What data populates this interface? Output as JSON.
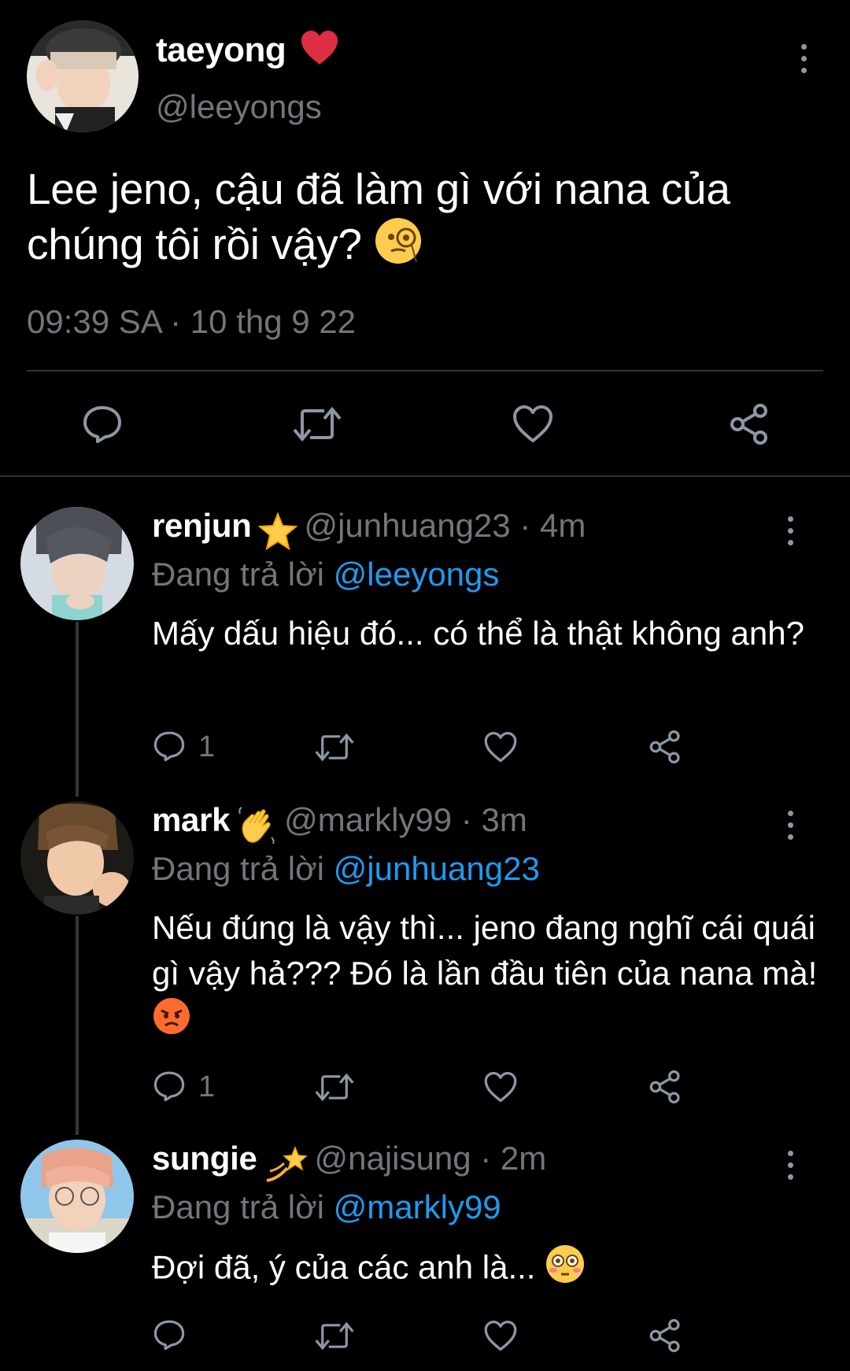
{
  "main_tweet": {
    "name": "taeyong",
    "name_emoji": "heart-emoji",
    "handle": "@leeyongs",
    "text": "Lee jeno, cậu đã làm gì với nana của chúng tôi rồi vậy?",
    "text_emoji": "monocle-face-emoji",
    "timestamp": "09:39 SA · 10 thg 9 22"
  },
  "replies": [
    {
      "name": "renjun",
      "name_emoji": "star-emoji",
      "meta": "@junhuang23 · 4m",
      "replying_prefix": "Đang trả lời",
      "replying_to": "@leeyongs",
      "text": "Mấy dấu hiệu đó... có thể là thật không anh?",
      "reply_count": "1"
    },
    {
      "name": "mark",
      "name_emoji": "waving-hand-emoji",
      "meta": "@markly99 · 3m",
      "replying_prefix": "Đang trả lời",
      "replying_to": "@junhuang23",
      "text": "Nếu đúng là vậy thì... jeno đang nghĩ cái quái gì vậy hả??? Đó là lần đầu tiên của nana mà!",
      "text_emoji": "angry-face-emoji",
      "reply_count": "1"
    },
    {
      "name": "sungie",
      "name_emoji": "dizzy-emoji",
      "meta": "@najisung · 2m",
      "replying_prefix": "Đang trả lời",
      "replying_to": "@markly99",
      "text": "Đợi đã, ý của các anh là...",
      "text_emoji": "flushed-face-emoji",
      "reply_count": ""
    }
  ],
  "colors": {
    "background": "#000000",
    "text": "#ffffff",
    "muted": "#71767b",
    "mention": "#1d9bf0",
    "divider": "#2f3336"
  }
}
